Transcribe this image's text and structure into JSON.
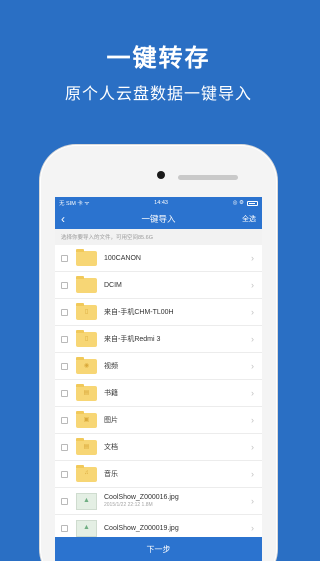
{
  "hero": {
    "title": "一键转存",
    "subtitle": "原个人云盘数据一键导入"
  },
  "status_bar": {
    "carrier": "无 SIM 卡 ᯤ",
    "time": "14:43",
    "right_icons": "◎ ⚙"
  },
  "nav": {
    "back_icon": "‹",
    "title": "一键导入",
    "action": "全选"
  },
  "hint": "选择你要导入的文件，可用空间85.6G",
  "items": [
    {
      "name": "100CANON",
      "type": "folder",
      "glyph": ""
    },
    {
      "name": "DCIM",
      "type": "folder",
      "glyph": ""
    },
    {
      "name": "来自-手机CHM-TL00H",
      "type": "folder",
      "glyph": "▯"
    },
    {
      "name": "来自-手机Redmi 3",
      "type": "folder",
      "glyph": "▯"
    },
    {
      "name": "视频",
      "type": "folder",
      "glyph": "◉"
    },
    {
      "name": "书籍",
      "type": "folder",
      "glyph": "▤"
    },
    {
      "name": "图片",
      "type": "folder",
      "glyph": "▣"
    },
    {
      "name": "文档",
      "type": "folder",
      "glyph": "▤"
    },
    {
      "name": "音乐",
      "type": "folder",
      "glyph": "♫"
    },
    {
      "name": "CoolShow_Z000016.jpg",
      "type": "image",
      "glyph": "▲",
      "meta": "2015/1/22 22:12 1.8M"
    },
    {
      "name": "CoolShow_Z000019.jpg",
      "type": "image",
      "glyph": "▲",
      "meta": ""
    }
  ],
  "chevron": "›",
  "footer": "下一步",
  "colors": {
    "background": "#2a6fc4",
    "primary": "#2b73cf",
    "folder": "#f7d675"
  }
}
